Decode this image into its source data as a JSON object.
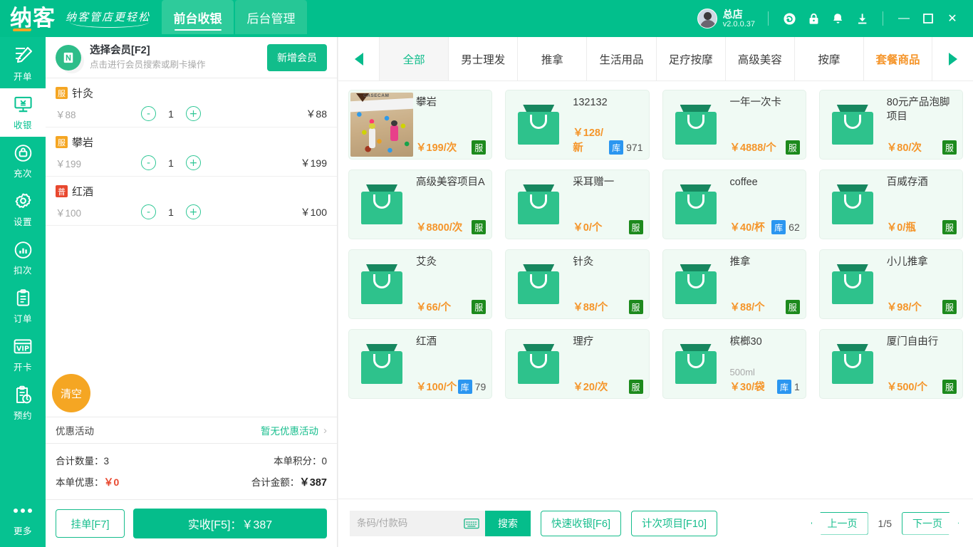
{
  "brand": {
    "logo": "纳客",
    "slogan": "纳客管店更轻松"
  },
  "main_tabs": [
    {
      "label": "前台收银",
      "active": true
    },
    {
      "label": "后台管理",
      "active": false
    }
  ],
  "titlebar": {
    "store_name": "总店",
    "version": "v2.0.0.37",
    "icons": [
      "headset-icon",
      "lock-icon",
      "bell-icon",
      "download-icon"
    ],
    "window_controls": {
      "minimize": "—",
      "maximize": "☐",
      "close": "✕"
    }
  },
  "rail": [
    {
      "label": "开单",
      "icon": "create-order-icon",
      "active": false
    },
    {
      "label": "收银",
      "icon": "cashier-monitor-icon",
      "active": true
    },
    {
      "label": "充次",
      "icon": "recharge-times-icon",
      "active": false
    },
    {
      "label": "设置",
      "icon": "gear-icon",
      "active": false
    },
    {
      "label": "扣次",
      "icon": "deduct-times-chart-icon",
      "active": false
    },
    {
      "label": "订单",
      "icon": "clipboard-order-icon",
      "active": false
    },
    {
      "label": "开卡",
      "icon": "vip-card-icon",
      "active": false
    },
    {
      "label": "预约",
      "icon": "appointment-clock-icon",
      "active": false
    },
    {
      "label": "更多",
      "icon": "more-dots-icon",
      "active": false
    }
  ],
  "member": {
    "title": "选择会员[F2]",
    "subtitle": "点击进行会员搜索或刷卡操作",
    "add_button": "新增会员"
  },
  "cart": {
    "items": [
      {
        "badge": "服",
        "badge_type": "service",
        "name": "针灸",
        "price": "￥88",
        "qty": "1",
        "total": "￥88"
      },
      {
        "badge": "服",
        "badge_type": "service",
        "name": "攀岩",
        "price": "￥199",
        "qty": "1",
        "total": "￥199"
      },
      {
        "badge": "普",
        "badge_type": "general",
        "name": "红酒",
        "price": "￥100",
        "qty": "1",
        "total": "￥100"
      }
    ],
    "minus": "-",
    "plus": "+",
    "clear_button": "清空"
  },
  "promo": {
    "label": "优惠活动",
    "value": "暂无优惠活动",
    "chevron": "›"
  },
  "totals": {
    "qty_label": "合计数量：",
    "qty_value": "3",
    "points_label": "本单积分：",
    "points_value": "0",
    "discount_label": "本单优惠：",
    "discount_value": "￥0",
    "amount_label": "合计金额：",
    "amount_value": "￥387"
  },
  "cart_actions": {
    "hold": "挂单[F7]",
    "pay": "实收[F5]：￥387"
  },
  "categories": [
    {
      "label": "全部",
      "state": "active"
    },
    {
      "label": "男士理发",
      "state": "normal"
    },
    {
      "label": "推拿",
      "state": "normal"
    },
    {
      "label": "生活用品",
      "state": "normal"
    },
    {
      "label": "足疗按摩",
      "state": "normal"
    },
    {
      "label": "高级美容",
      "state": "normal"
    },
    {
      "label": "按摩",
      "state": "normal"
    },
    {
      "label": "套餐商品",
      "state": "highlight"
    }
  ],
  "products": [
    {
      "name": "攀岩",
      "price": "￥199/次",
      "thumb": "climbing-photo",
      "tag": "服",
      "spec": "",
      "stock": ""
    },
    {
      "name": "132132",
      "price": "￥128/新",
      "thumb": "bag-icon",
      "tag": "",
      "spec": "",
      "stock": "971"
    },
    {
      "name": "一年一次卡",
      "price": "￥4888/个",
      "thumb": "bag-icon",
      "tag": "服",
      "spec": "",
      "stock": ""
    },
    {
      "name": "80元产品泡脚项目",
      "price": "￥80/次",
      "thumb": "bag-icon",
      "tag": "服",
      "spec": "",
      "stock": ""
    },
    {
      "name": "高级美容项目A",
      "price": "￥8800/次",
      "thumb": "bag-icon",
      "tag": "服",
      "spec": "",
      "stock": ""
    },
    {
      "name": "采耳赠一",
      "price": "￥0/个",
      "thumb": "bag-icon",
      "tag": "服",
      "spec": "",
      "stock": ""
    },
    {
      "name": "coffee",
      "price": "￥40/杯",
      "thumb": "bag-icon",
      "tag": "",
      "spec": "",
      "stock": "62"
    },
    {
      "name": "百威存酒",
      "price": "￥0/瓶",
      "thumb": "bag-icon",
      "tag": "服",
      "spec": "",
      "stock": ""
    },
    {
      "name": "艾灸",
      "price": "￥66/个",
      "thumb": "bag-icon",
      "tag": "服",
      "spec": "",
      "stock": ""
    },
    {
      "name": "针灸",
      "price": "￥88/个",
      "thumb": "bag-icon",
      "tag": "服",
      "spec": "",
      "stock": ""
    },
    {
      "name": "推拿",
      "price": "￥88/个",
      "thumb": "bag-icon",
      "tag": "服",
      "spec": "",
      "stock": ""
    },
    {
      "name": "小儿推拿",
      "price": "￥98/个",
      "thumb": "bag-icon",
      "tag": "服",
      "spec": "",
      "stock": ""
    },
    {
      "name": "红酒",
      "price": "￥100/个",
      "thumb": "bag-icon",
      "tag": "",
      "spec": "",
      "stock": "79"
    },
    {
      "name": "理疗",
      "price": "￥20/次",
      "thumb": "bag-icon",
      "tag": "服",
      "spec": "",
      "stock": ""
    },
    {
      "name": "槟榔30",
      "price": "￥30/袋",
      "thumb": "bag-icon",
      "tag": "",
      "spec": "500ml",
      "stock": "1"
    },
    {
      "name": "厦门自由行",
      "price": "￥500/个",
      "thumb": "bag-icon",
      "tag": "服",
      "spec": "",
      "stock": ""
    }
  ],
  "stock_tag": "库",
  "bottom_bar": {
    "search_placeholder": "条码/付款码",
    "search_value": "",
    "keyboard_icon": "keyboard-icon",
    "search_button": "搜索",
    "quick_pay": "快速收银[F6]",
    "times_item": "计次项目[F10]",
    "prev_page": "上一页",
    "page_info": "1/5",
    "next_page": "下一页"
  },
  "colors": {
    "brand_green": "#02bf8c",
    "rail_green": "#06c291",
    "accent_orange": "#f5952a",
    "tag_green": "#1d8a1d",
    "stock_blue": "#2b96f0",
    "badge_service": "#f5a623",
    "badge_general": "#e8482f",
    "discount_red": "#e8482f"
  }
}
